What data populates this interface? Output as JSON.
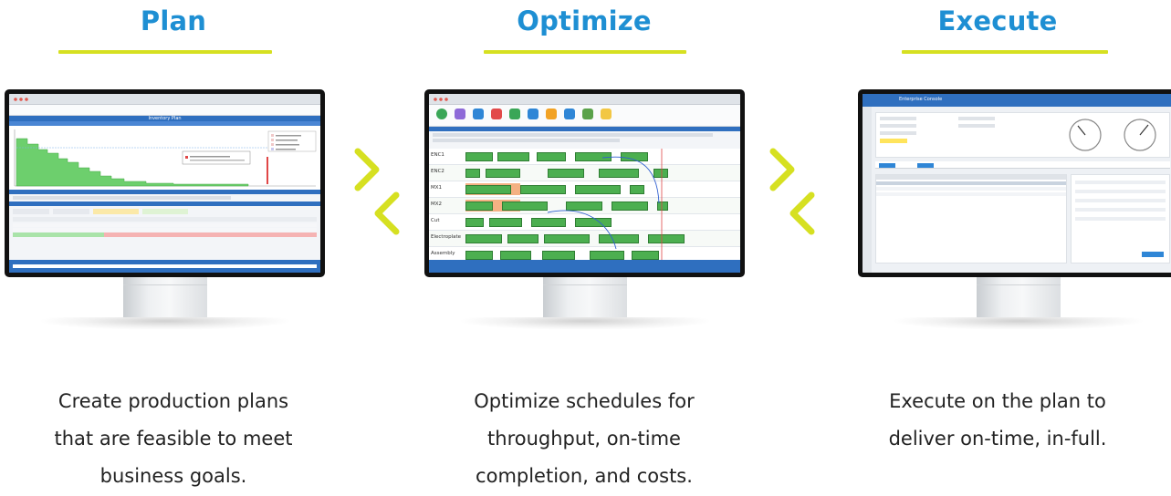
{
  "steps": [
    {
      "title": "Plan",
      "caption_lines": [
        "Create production plans",
        "that are feasible to meet",
        "business goals."
      ]
    },
    {
      "title": "Optimize",
      "caption_lines": [
        "Optimize schedules for",
        "throughput, on-time",
        "completion, and costs."
      ]
    },
    {
      "title": "Execute",
      "caption_lines": [
        "Execute on the plan to",
        "deliver on-time, in-full."
      ]
    }
  ],
  "screens": {
    "plan": {
      "header": "Inventory Plan"
    },
    "optimize": {
      "resources": [
        "ENC1",
        "ENC2",
        "MX1",
        "MX2",
        "Cut",
        "Electroplate",
        "Assembly"
      ]
    },
    "execute": {
      "header": "Enterprise Console"
    }
  },
  "colors": {
    "title_blue": "#1e8fd3",
    "accent_lime": "#d6e021",
    "caption_text": "#222222",
    "gantt_green": "#4caf50",
    "gantt_orange": "#f4b183"
  },
  "icons": [
    "forward-chevron-icon",
    "backward-chevron-icon"
  ]
}
